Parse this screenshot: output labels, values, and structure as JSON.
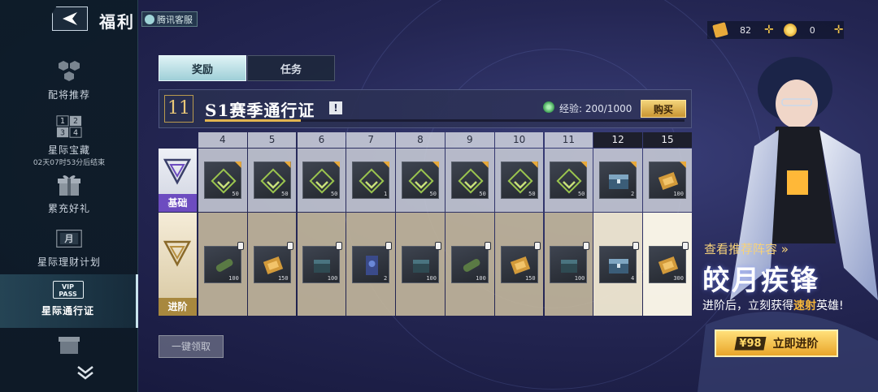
{
  "header": {
    "title": "福利",
    "customer_service": "腾讯客服"
  },
  "sidebar": {
    "items": [
      {
        "label": "配将推荐",
        "sub": "",
        "icon": "hexagon-cluster-icon"
      },
      {
        "label": "星际宝藏",
        "sub": "02天07时53分后结束",
        "icon": "number-grid-icon",
        "digits": [
          "1",
          "2",
          "3",
          "4"
        ]
      },
      {
        "label": "累充好礼",
        "sub": "",
        "icon": "gift-icon"
      },
      {
        "label": "星际理财计划",
        "sub": "",
        "icon": "calendar-month-icon",
        "glyph": "月"
      },
      {
        "label": "星际通行证",
        "sub": "",
        "icon": "vip-pass-icon",
        "active": true,
        "badge": "VIP PASS"
      }
    ]
  },
  "currency": [
    {
      "icon": "ticket-icon",
      "value": "82",
      "color": "#e8a93a"
    },
    {
      "icon": "gold-coin-icon",
      "value": "0",
      "color": "#f0c23a"
    }
  ],
  "tabs": [
    {
      "label": "奖励",
      "active": true
    },
    {
      "label": "任务",
      "active": false
    }
  ],
  "season": {
    "level": "11",
    "title": "S1赛季通行证",
    "info": "!",
    "exp_label": "经验:",
    "exp_value": "200/1000",
    "exp_progress": 0.2,
    "buy_label": "购买"
  },
  "grid": {
    "basic_label": "基础",
    "adv_label": "进阶",
    "columns": [
      {
        "level": "4",
        "basic_qty": "50",
        "basic_icon": "badge-chevron-icon",
        "adv_qty": "100",
        "adv_icon": "tube-icon"
      },
      {
        "level": "5",
        "basic_qty": "50",
        "basic_icon": "badge-chevron-icon",
        "adv_qty": "150",
        "adv_icon": "chip-icon"
      },
      {
        "level": "6",
        "basic_qty": "50",
        "basic_icon": "badge-chevron-icon",
        "adv_qty": "100",
        "adv_icon": "crate-icon"
      },
      {
        "level": "7",
        "basic_qty": "1",
        "basic_icon": "badge-chevron-icon",
        "adv_qty": "2",
        "adv_icon": "card-icon"
      },
      {
        "level": "8",
        "basic_qty": "50",
        "basic_icon": "badge-chevron-icon",
        "adv_qty": "100",
        "adv_icon": "crate-icon"
      },
      {
        "level": "9",
        "basic_qty": "50",
        "basic_icon": "badge-chevron-icon",
        "adv_qty": "100",
        "adv_icon": "tube-icon"
      },
      {
        "level": "10",
        "basic_qty": "50",
        "basic_icon": "badge-chevron-icon",
        "adv_qty": "150",
        "adv_icon": "chip-icon"
      },
      {
        "level": "11",
        "basic_qty": "50",
        "basic_icon": "badge-chevron-icon",
        "adv_qty": "100",
        "adv_icon": "crate-icon"
      },
      {
        "level": "12",
        "basic_qty": "2",
        "basic_icon": "chest-icon",
        "adv_qty": "4",
        "adv_icon": "chest-icon"
      },
      {
        "level": "15",
        "basic_qty": "100",
        "basic_icon": "chip-icon",
        "adv_qty": "300",
        "adv_icon": "chip-icon"
      }
    ]
  },
  "claim_all": "一键领取",
  "promo": {
    "link": "查看推荐阵容 »",
    "title": "皎月疾锋",
    "sub_prefix": "进阶后，立刻获得",
    "sub_highlight": "速射",
    "sub_suffix": "英雄!",
    "price": "¥98",
    "button": "立即进阶"
  }
}
